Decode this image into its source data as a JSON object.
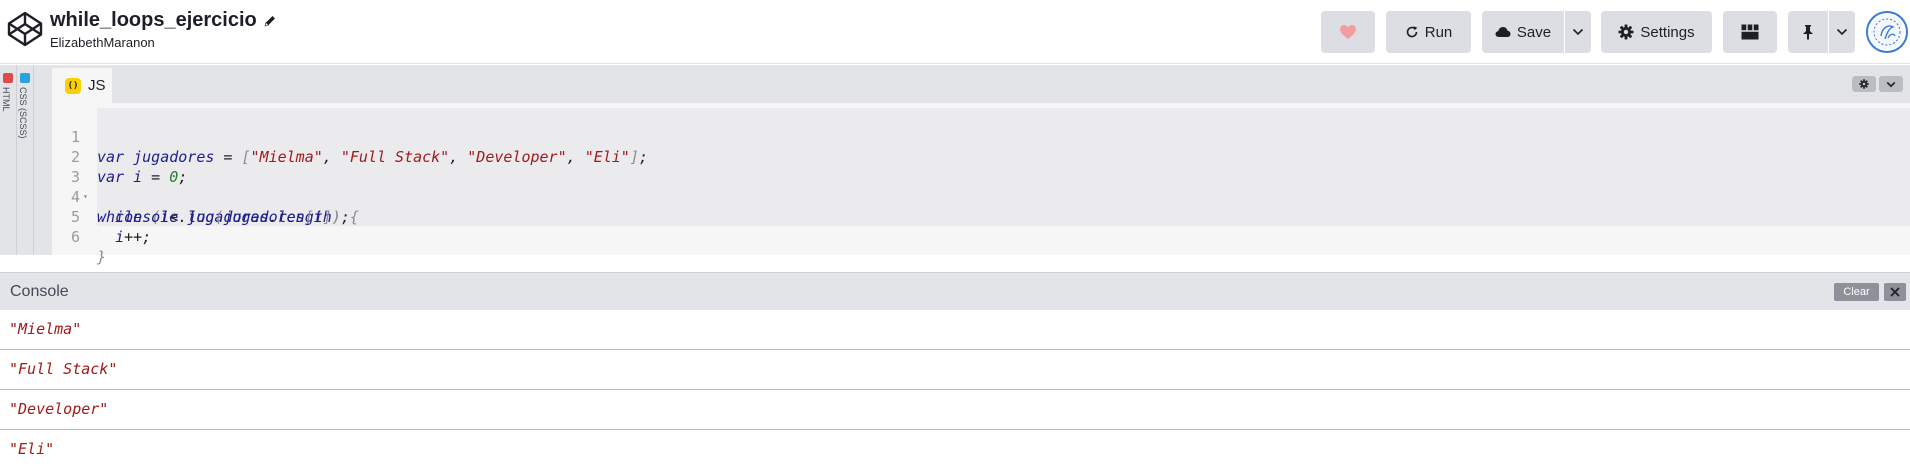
{
  "header": {
    "title": "while_loops_ejercicio",
    "author": "ElizabethMaranon",
    "buttons": {
      "run_label": "Run",
      "save_label": "Save",
      "settings_label": "Settings"
    },
    "heart_color": "#f09ea0"
  },
  "editor": {
    "collapsed_panels": [
      {
        "label": "HTML",
        "color": "#e04a4a"
      },
      {
        "label": "CSS (SCSS)",
        "color": "#28a3e0"
      }
    ],
    "js_tab_label": "JS",
    "js_badge": "()",
    "line_numbers": [
      "1",
      "2",
      "3",
      "4",
      "5",
      "6"
    ]
  },
  "console": {
    "title": "Console",
    "clear_label": "Clear",
    "logs": [
      "\"Mielma\"",
      "\"Full Stack\"",
      "\"Developer\"",
      "\"Eli\""
    ]
  }
}
